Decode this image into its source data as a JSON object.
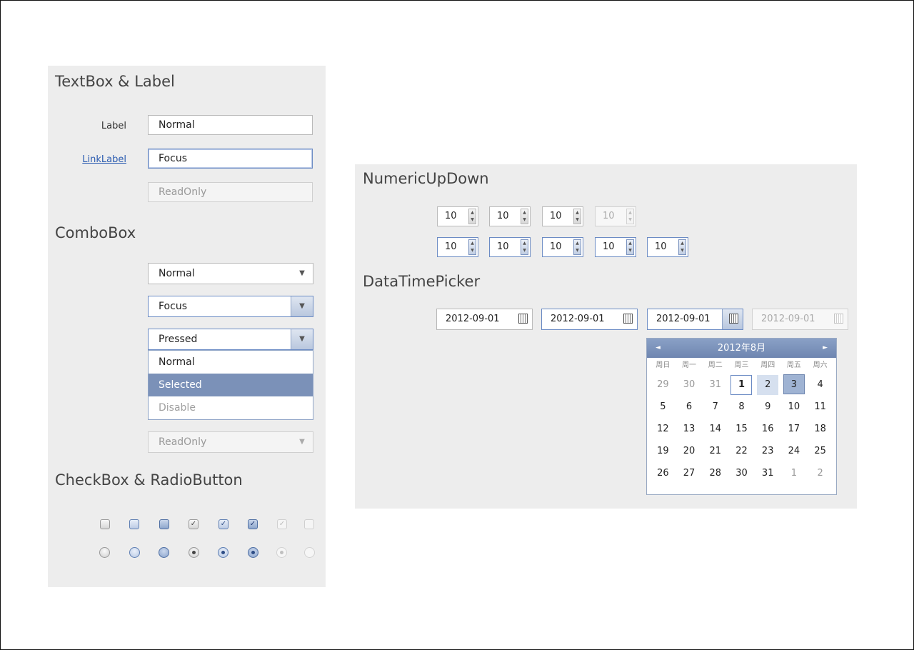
{
  "textbox_section": {
    "title": "TextBox & Label",
    "label_text": "Label",
    "linklabel_text": "LinkLabel",
    "normal_value": "Normal",
    "focus_value": "Focus",
    "readonly_value": "ReadOnly"
  },
  "combobox_section": {
    "title": "ComboBox",
    "normal_value": "Normal",
    "focus_value": "Focus",
    "pressed_value": "Pressed",
    "dropdown_items": [
      "Normal",
      "Selected",
      "Disable"
    ],
    "readonly_value": "ReadOnly"
  },
  "checkbox_section": {
    "title": "CheckBox & RadioButton",
    "states": [
      "normal",
      "hover",
      "pressed",
      "checked-normal",
      "checked-hover",
      "checked-pressed",
      "checked-disabled",
      "disabled"
    ]
  },
  "numeric_section": {
    "title": "NumericUpDown",
    "value": "10"
  },
  "datetime_section": {
    "title": "DataTimePicker",
    "value": "2012-09-01",
    "calendar": {
      "month_label": "2012年8月",
      "prev_icon": "◄",
      "next_icon": "►",
      "weekdays": [
        "周日",
        "周一",
        "周二",
        "周三",
        "周四",
        "周五",
        "周六"
      ],
      "weeks": [
        [
          "29",
          "30",
          "31",
          "1",
          "2",
          "3",
          "4"
        ],
        [
          "5",
          "6",
          "7",
          "8",
          "9",
          "10",
          "11"
        ],
        [
          "12",
          "13",
          "14",
          "15",
          "16",
          "17",
          "18"
        ],
        [
          "19",
          "20",
          "21",
          "22",
          "23",
          "24",
          "25"
        ],
        [
          "26",
          "27",
          "28",
          "30",
          "31",
          "1",
          "2"
        ]
      ]
    }
  },
  "colors": {
    "accent": "#6b8bc4",
    "selected": "#7b91b8",
    "panel": "#ededed"
  }
}
